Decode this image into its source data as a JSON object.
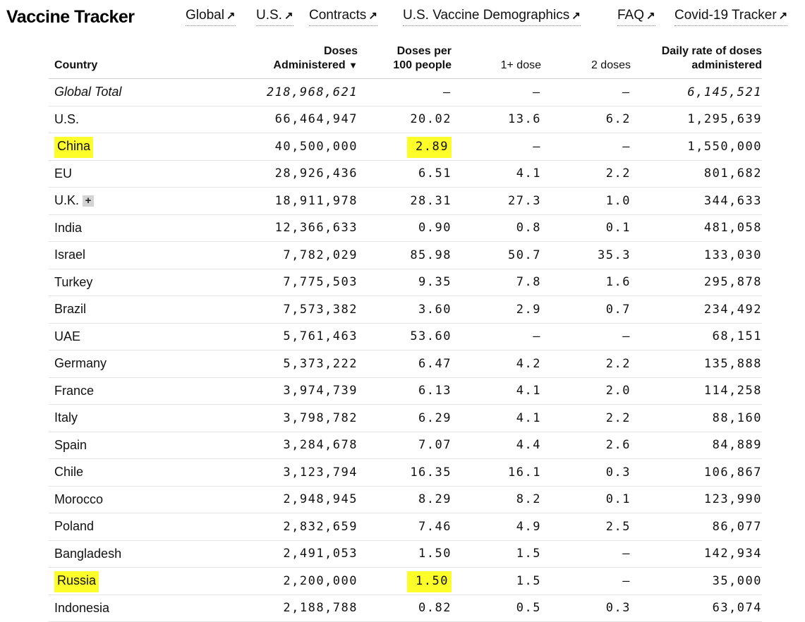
{
  "header": {
    "title": "Vaccine Tracker",
    "nav": [
      {
        "label": "Global",
        "icon": "arrow-up-right-icon"
      },
      {
        "label": "U.S.",
        "icon": "arrow-up-right-icon"
      },
      {
        "label": "Contracts",
        "icon": "arrow-up-right-icon"
      },
      {
        "label": "U.S. Vaccine Demographics",
        "icon": "arrow-up-right-icon"
      },
      {
        "label": "FAQ",
        "icon": "arrow-up-right-icon"
      },
      {
        "label": "Covid-19 Tracker",
        "icon": "arrow-up-right-icon"
      }
    ]
  },
  "table": {
    "columns": {
      "country": "Country",
      "doses_line1": "Doses",
      "doses_line2": "Administered",
      "sort_indicator": "▼",
      "per100_line1": "Doses per",
      "per100_line2": "100 people",
      "one_dose": "1+ dose",
      "two_doses": "2 doses",
      "daily_line1": "Daily rate of doses",
      "daily_line2": "administered"
    },
    "expand_label": "+",
    "highlight_color": "#fdfd2a",
    "rows": [
      {
        "country": "Global Total",
        "doses": "218,968,621",
        "per100": "–",
        "one": "–",
        "two": "–",
        "daily": "6,145,521"
      },
      {
        "country": "U.S.",
        "doses": "66,464,947",
        "per100": "20.02",
        "one": "13.6",
        "two": "6.2",
        "daily": "1,295,639"
      },
      {
        "country": "China",
        "doses": "40,500,000",
        "per100": "2.89",
        "one": "–",
        "two": "–",
        "daily": "1,550,000"
      },
      {
        "country": "EU",
        "doses": "28,926,436",
        "per100": "6.51",
        "one": "4.1",
        "two": "2.2",
        "daily": "801,682"
      },
      {
        "country": "U.K.",
        "doses": "18,911,978",
        "per100": "28.31",
        "one": "27.3",
        "two": "1.0",
        "daily": "344,633"
      },
      {
        "country": "India",
        "doses": "12,366,633",
        "per100": "0.90",
        "one": "0.8",
        "two": "0.1",
        "daily": "481,058"
      },
      {
        "country": "Israel",
        "doses": "7,782,029",
        "per100": "85.98",
        "one": "50.7",
        "two": "35.3",
        "daily": "133,030"
      },
      {
        "country": "Turkey",
        "doses": "7,775,503",
        "per100": "9.35",
        "one": "7.8",
        "two": "1.6",
        "daily": "295,878"
      },
      {
        "country": "Brazil",
        "doses": "7,573,382",
        "per100": "3.60",
        "one": "2.9",
        "two": "0.7",
        "daily": "234,492"
      },
      {
        "country": "UAE",
        "doses": "5,761,463",
        "per100": "53.60",
        "one": "–",
        "two": "–",
        "daily": "68,151"
      },
      {
        "country": "Germany",
        "doses": "5,373,222",
        "per100": "6.47",
        "one": "4.2",
        "two": "2.2",
        "daily": "135,888"
      },
      {
        "country": "France",
        "doses": "3,974,739",
        "per100": "6.13",
        "one": "4.1",
        "two": "2.0",
        "daily": "114,258"
      },
      {
        "country": "Italy",
        "doses": "3,798,782",
        "per100": "6.29",
        "one": "4.1",
        "two": "2.2",
        "daily": "88,160"
      },
      {
        "country": "Spain",
        "doses": "3,284,678",
        "per100": "7.07",
        "one": "4.4",
        "two": "2.6",
        "daily": "84,889"
      },
      {
        "country": "Chile",
        "doses": "3,123,794",
        "per100": "16.35",
        "one": "16.1",
        "two": "0.3",
        "daily": "106,867"
      },
      {
        "country": "Morocco",
        "doses": "2,948,945",
        "per100": "8.29",
        "one": "8.2",
        "two": "0.1",
        "daily": "123,990"
      },
      {
        "country": "Poland",
        "doses": "2,832,659",
        "per100": "7.46",
        "one": "4.9",
        "two": "2.5",
        "daily": "86,077"
      },
      {
        "country": "Bangladesh",
        "doses": "2,491,053",
        "per100": "1.50",
        "one": "1.5",
        "two": "–",
        "daily": "142,934"
      },
      {
        "country": "Russia",
        "doses": "2,200,000",
        "per100": "1.50",
        "one": "1.5",
        "two": "–",
        "daily": "35,000"
      },
      {
        "country": "Indonesia",
        "doses": "2,188,788",
        "per100": "0.82",
        "one": "0.5",
        "two": "0.3",
        "daily": "63,074"
      }
    ]
  }
}
